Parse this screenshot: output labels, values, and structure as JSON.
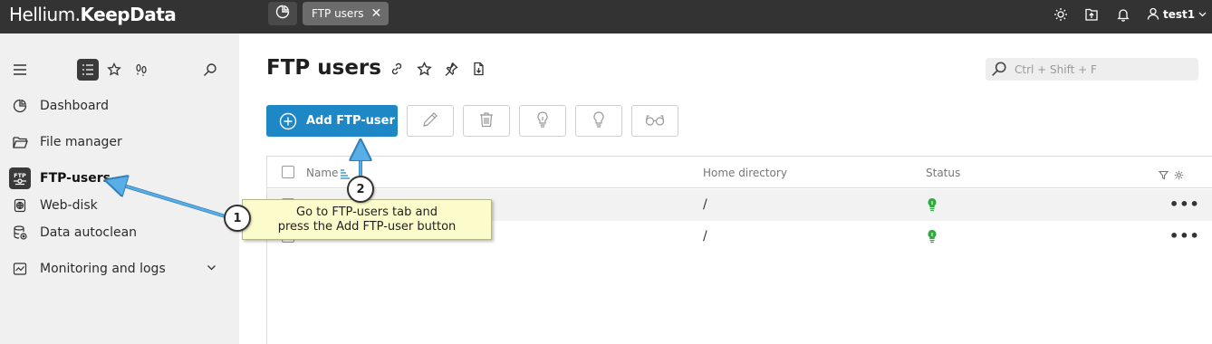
{
  "topbar": {
    "logo_part1": "Hellium.",
    "logo_part2": "KeepData",
    "tab_label": "FTP users",
    "tab_close": "✕",
    "user_name": "test1"
  },
  "sidebar": {
    "items": [
      {
        "label": "Dashboard",
        "icon": "dashboard-icon"
      },
      {
        "label": "File manager",
        "icon": "folder-icon"
      },
      {
        "label": "FTP-users",
        "icon": "ftp-icon"
      },
      {
        "label": "Web-disk",
        "icon": "web-disk-icon"
      },
      {
        "label": "Data autoclean",
        "icon": "autoclean-icon"
      },
      {
        "label": "Monitoring and logs",
        "icon": "monitoring-icon"
      }
    ]
  },
  "main": {
    "title": "FTP users",
    "search_placeholder": "Ctrl + Shift + F",
    "add_button_label": "Add FTP-user",
    "table": {
      "columns": [
        "Name",
        "Home directory",
        "Status"
      ],
      "rows": [
        {
          "home": "/",
          "status": "active"
        },
        {
          "home": "/",
          "status": "active"
        }
      ],
      "row_menu": "•••"
    }
  },
  "annotation": {
    "line1": "Go to FTP-users tab and",
    "line2": "press the Add FTP-user button",
    "step1": "1",
    "step2": "2"
  },
  "colors": {
    "topbar": "#333333",
    "accent": "#1e88c7",
    "status_active": "#2eaa3f",
    "callout_bg": "#fbfbcc",
    "arrow": "#5aaee6"
  }
}
